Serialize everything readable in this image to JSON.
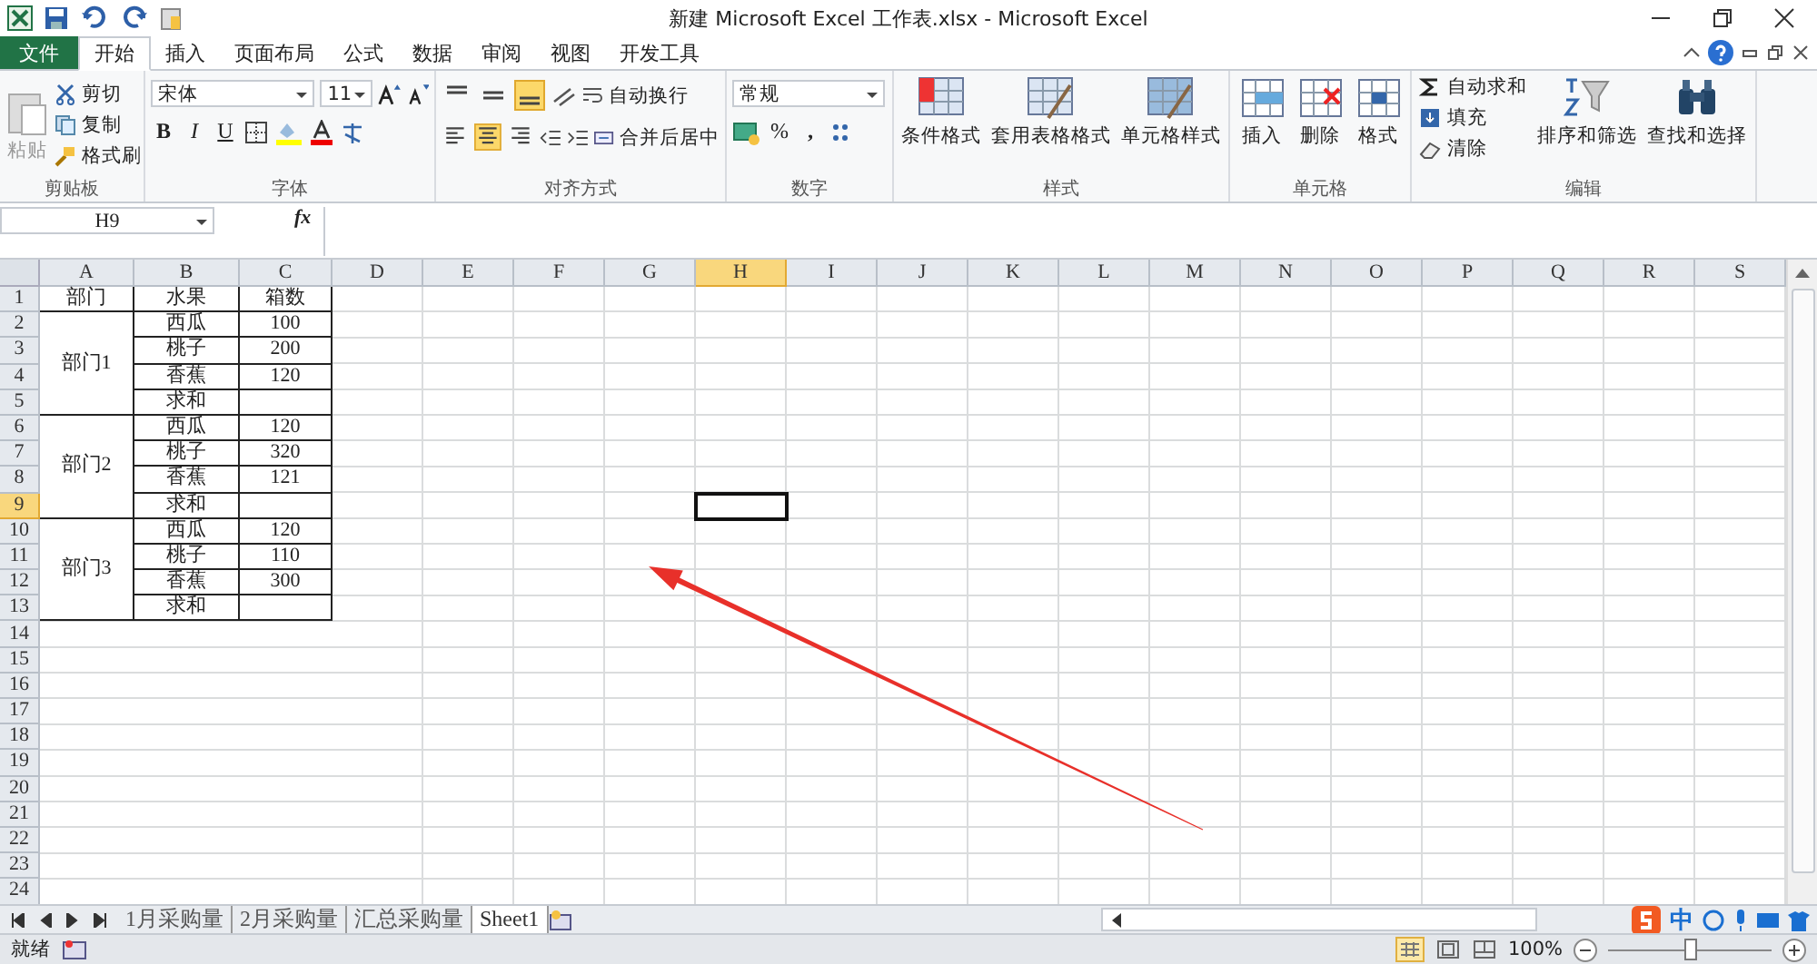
{
  "window": {
    "title": "新建 Microsoft Excel 工作表.xlsx - Microsoft Excel"
  },
  "file_tab": "文件",
  "tabs": [
    {
      "label": "开始",
      "selected": true
    },
    {
      "label": "插入",
      "selected": false
    },
    {
      "label": "页面布局",
      "selected": false
    },
    {
      "label": "公式",
      "selected": false
    },
    {
      "label": "数据",
      "selected": false
    },
    {
      "label": "审阅",
      "selected": false
    },
    {
      "label": "视图",
      "selected": false
    },
    {
      "label": "开发工具",
      "selected": false
    }
  ],
  "ribbon": {
    "clipboard": {
      "label": "剪贴板",
      "paste": "粘贴",
      "items": [
        "剪切",
        "复制",
        "格式刷"
      ]
    },
    "font": {
      "label": "字体",
      "font_name": "宋体",
      "font_size": "11",
      "bold": "B",
      "italic": "I",
      "underline": "U"
    },
    "alignment": {
      "label": "对齐方式",
      "wrap": "自动换行",
      "merge": "合并后居中",
      "vertical": [
        {
          "selected": false
        },
        {
          "selected": false
        },
        {
          "selected": true
        }
      ],
      "horizontal": [
        {
          "selected": false
        },
        {
          "selected": true
        },
        {
          "selected": false
        }
      ]
    },
    "number": {
      "label": "数字",
      "format": "常规",
      "percent": "%",
      "comma": ","
    },
    "styles": {
      "label": "样式",
      "buttons": [
        "条件格式",
        "套用表格格式",
        "单元格样式"
      ]
    },
    "cells": {
      "label": "单元格",
      "buttons": [
        "插入",
        "删除",
        "格式"
      ]
    },
    "editing": {
      "label": "编辑",
      "small": [
        "自动求和",
        "填充",
        "清除"
      ],
      "big": [
        "排序和筛选",
        "查找和选择"
      ]
    }
  },
  "formula_bar": {
    "name_box": "H9",
    "fx": "fx"
  },
  "sheet": {
    "columns": [
      {
        "label": "A",
        "selected": false
      },
      {
        "label": "B",
        "selected": false
      },
      {
        "label": "C",
        "selected": false
      },
      {
        "label": "D",
        "selected": false
      },
      {
        "label": "E",
        "selected": false
      },
      {
        "label": "F",
        "selected": false
      },
      {
        "label": "G",
        "selected": false
      },
      {
        "label": "H",
        "selected": true
      },
      {
        "label": "I",
        "selected": false
      },
      {
        "label": "J",
        "selected": false
      },
      {
        "label": "K",
        "selected": false
      },
      {
        "label": "L",
        "selected": false
      },
      {
        "label": "M",
        "selected": false
      },
      {
        "label": "N",
        "selected": false
      },
      {
        "label": "O",
        "selected": false
      },
      {
        "label": "P",
        "selected": false
      },
      {
        "label": "Q",
        "selected": false
      },
      {
        "label": "R",
        "selected": false
      },
      {
        "label": "S",
        "selected": false
      }
    ],
    "rows": [
      {
        "label": "1",
        "selected": false
      },
      {
        "label": "2",
        "selected": false
      },
      {
        "label": "3",
        "selected": false
      },
      {
        "label": "4",
        "selected": false
      },
      {
        "label": "5",
        "selected": false
      },
      {
        "label": "6",
        "selected": false
      },
      {
        "label": "7",
        "selected": false
      },
      {
        "label": "8",
        "selected": false
      },
      {
        "label": "9",
        "selected": true
      },
      {
        "label": "10",
        "selected": false
      },
      {
        "label": "11",
        "selected": false
      },
      {
        "label": "12",
        "selected": false
      },
      {
        "label": "13",
        "selected": false
      },
      {
        "label": "14",
        "selected": false
      },
      {
        "label": "15",
        "selected": false
      },
      {
        "label": "16",
        "selected": false
      },
      {
        "label": "17",
        "selected": false
      },
      {
        "label": "18",
        "selected": false
      },
      {
        "label": "19",
        "selected": false
      },
      {
        "label": "20",
        "selected": false
      },
      {
        "label": "21",
        "selected": false
      },
      {
        "label": "22",
        "selected": false
      },
      {
        "label": "23",
        "selected": false
      },
      {
        "label": "24",
        "selected": false
      }
    ],
    "header": [
      "部门",
      "水果",
      "箱数"
    ],
    "groups": [
      {
        "name": "部门1",
        "rows": [
          [
            "西瓜",
            "100"
          ],
          [
            "桃子",
            "200"
          ],
          [
            "香蕉",
            "120"
          ],
          [
            "求和"
          ]
        ]
      },
      {
        "name": "部门2",
        "rows": [
          [
            "西瓜",
            "120"
          ],
          [
            "桃子",
            "320"
          ],
          [
            "香蕉",
            "121"
          ],
          [
            "求和"
          ]
        ]
      },
      {
        "name": "部门3",
        "rows": [
          [
            "西瓜",
            "120"
          ],
          [
            "桃子",
            "110"
          ],
          [
            "香蕉",
            "300"
          ],
          [
            "求和"
          ]
        ]
      }
    ]
  },
  "sheet_tabs": [
    {
      "label": "1月采购量",
      "selected": false
    },
    {
      "label": "2月采购量",
      "selected": false
    },
    {
      "label": "汇总采购量",
      "selected": false
    },
    {
      "label": "Sheet1",
      "selected": true
    }
  ],
  "ime": {
    "label": "中"
  },
  "status_bar": {
    "status": "就绪",
    "zoom": "100%",
    "zoom_slider": {
      "level": 0.5
    }
  }
}
